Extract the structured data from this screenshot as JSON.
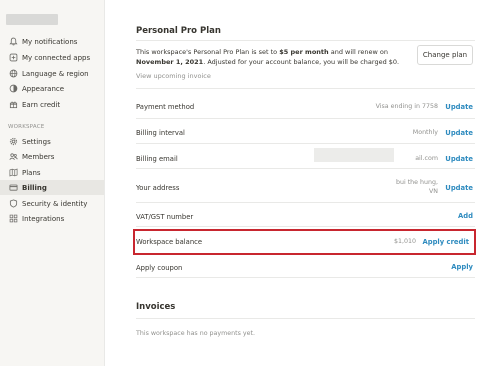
{
  "sidebar": {
    "account_items": [
      {
        "label": "My notifications",
        "icon": "bell-icon"
      },
      {
        "label": "My connected apps",
        "icon": "apps-icon"
      },
      {
        "label": "Language & region",
        "icon": "globe-icon"
      },
      {
        "label": "Appearance",
        "icon": "appearance-icon"
      },
      {
        "label": "Earn credit",
        "icon": "gift-icon"
      }
    ],
    "workspace_section": "WORKSPACE",
    "workspace_items": [
      {
        "label": "Settings",
        "icon": "gear-icon"
      },
      {
        "label": "Members",
        "icon": "members-icon"
      },
      {
        "label": "Plans",
        "icon": "map-icon"
      },
      {
        "label": "Billing",
        "icon": "card-icon",
        "active": true
      },
      {
        "label": "Security & identity",
        "icon": "shield-icon"
      },
      {
        "label": "Integrations",
        "icon": "grid-icon"
      }
    ]
  },
  "plan": {
    "title": "Personal Pro Plan",
    "desc_part1": "This workspace's Personal Pro Plan is set to ",
    "desc_price": "$5 per month",
    "desc_part2": " and will renew on ",
    "desc_date": "November 1, 2021",
    "desc_part3": ". Adjusted for your account balance, you will be charged $0.",
    "view_invoice": "View upcoming invoice",
    "change_button": "Change plan"
  },
  "billing": {
    "payment_method": {
      "label": "Payment method",
      "value": "Visa ending in 7758",
      "action": "Update"
    },
    "billing_interval": {
      "label": "Billing interval",
      "value": "Monthly",
      "action": "Update"
    },
    "billing_email": {
      "label": "Billing email",
      "value": "ail.com",
      "action": "Update"
    },
    "address": {
      "label": "Your address",
      "value_line1": "bui the hung,",
      "value_line2": "VN",
      "action": "Update"
    },
    "vat": {
      "label": "VAT/GST number",
      "action": "Add"
    },
    "balance": {
      "label": "Workspace balance",
      "value": "$1,010",
      "action": "Apply credit"
    },
    "coupon": {
      "label": "Apply coupon",
      "action": "Apply"
    }
  },
  "invoices": {
    "title": "Invoices",
    "empty": "This workspace has no payments yet."
  },
  "colors": {
    "link": "#2e8bbf",
    "highlight": "#c8262f"
  }
}
